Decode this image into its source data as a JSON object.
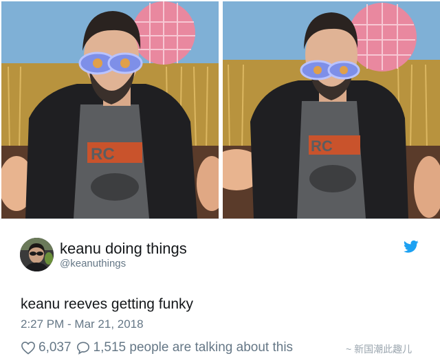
{
  "tweet": {
    "display_name": "keanu doing things",
    "handle": "@keanuthings",
    "text": "keanu reeves getting funky",
    "timestamp": "2:27 PM - Mar 21, 2018",
    "likes": "6,037",
    "replies_summary": "1,515 people are talking about this",
    "platform_icon": "twitter-bird-icon",
    "accent_color": "#1da1f2"
  },
  "media": {
    "photos": [
      {
        "name": "photo-left"
      },
      {
        "name": "photo-right"
      }
    ]
  },
  "watermark": {
    "text": "~ 新国潮此趣儿"
  }
}
